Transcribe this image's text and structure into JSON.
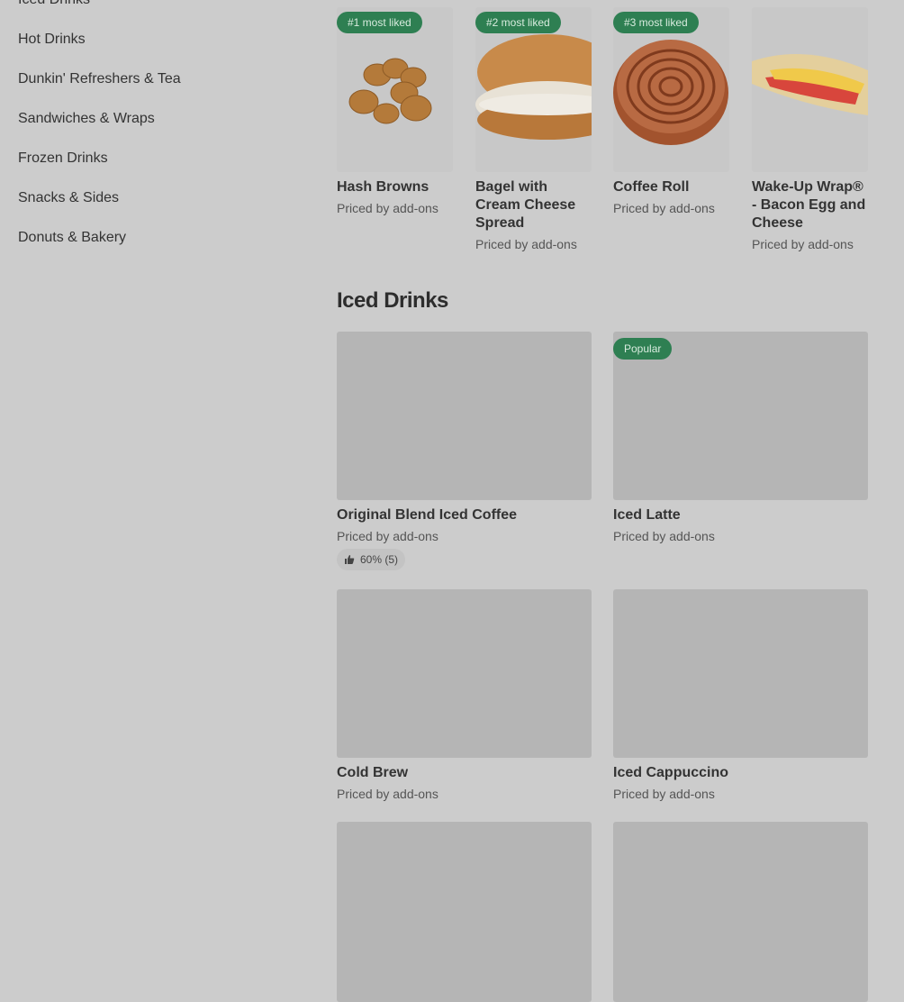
{
  "sidebar": {
    "items": [
      {
        "label": "Iced Drinks"
      },
      {
        "label": "Hot Drinks"
      },
      {
        "label": "Dunkin' Refreshers & Tea"
      },
      {
        "label": "Sandwiches & Wraps"
      },
      {
        "label": "Frozen Drinks"
      },
      {
        "label": "Snacks & Sides"
      },
      {
        "label": "Donuts & Bakery"
      }
    ]
  },
  "most_liked": [
    {
      "badge": "#1 most liked",
      "name": "Hash Browns",
      "price": "Priced by add-ons",
      "image": "hash-browns"
    },
    {
      "badge": "#2 most liked",
      "name": "Bagel with Cream Cheese Spread",
      "price": "Priced by add-ons",
      "image": "bagel"
    },
    {
      "badge": "#3 most liked",
      "name": "Coffee Roll",
      "price": "Priced by add-ons",
      "image": "coffee-roll"
    },
    {
      "badge": "",
      "name": "Wake-Up Wrap® - Bacon Egg and Cheese",
      "price": "Priced by add-ons",
      "image": "wrap"
    }
  ],
  "iced_drinks": {
    "title": "Iced Drinks",
    "items": [
      {
        "name": "Original Blend Iced Coffee",
        "price": "Priced by add-ons",
        "rating": "60% (5)",
        "badge": ""
      },
      {
        "name": "Iced Latte",
        "price": "Priced by add-ons",
        "badge": "Popular"
      },
      {
        "name": "Cold Brew",
        "price": "Priced by add-ons",
        "badge": ""
      },
      {
        "name": "Iced Cappuccino",
        "price": "Priced by add-ons",
        "badge": ""
      }
    ]
  },
  "colors": {
    "overlay_bg": "#cccccc",
    "badge_green": "#2e7f52",
    "placeholder": "#b5b5b5"
  }
}
